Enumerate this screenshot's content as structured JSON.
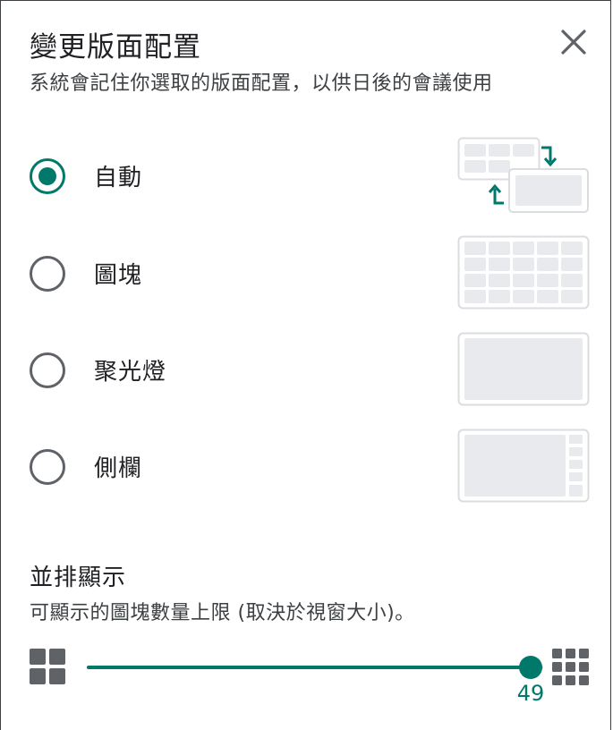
{
  "dialog": {
    "title": "變更版面配置",
    "subtitle": "系統會記住你選取的版面配置，以供日後的會議使用",
    "close_icon": "close-icon"
  },
  "layout_options": [
    {
      "label": "自動",
      "selected": true,
      "icon": "auto-layout-icon"
    },
    {
      "label": "圖塊",
      "selected": false,
      "icon": "tiled-layout-icon"
    },
    {
      "label": "聚光燈",
      "selected": false,
      "icon": "spotlight-layout-icon"
    },
    {
      "label": "側欄",
      "selected": false,
      "icon": "sidebar-layout-icon"
    }
  ],
  "tiles": {
    "title": "並排顯示",
    "description": "可顯示的圖塊數量上限 (取決於視窗大小)。",
    "slider": {
      "min": 2,
      "max": 49,
      "value": 49,
      "value_label": "49",
      "min_icon": "grid-small-icon",
      "max_icon": "grid-large-icon"
    }
  },
  "colors": {
    "accent": "#00796b",
    "text": "#202124",
    "secondary_text": "#3c4043",
    "radio_off": "#5f6368",
    "tile_fill": "#e8eaed",
    "tile_border": "#dadce0",
    "icon_gray": "#5f6368"
  }
}
